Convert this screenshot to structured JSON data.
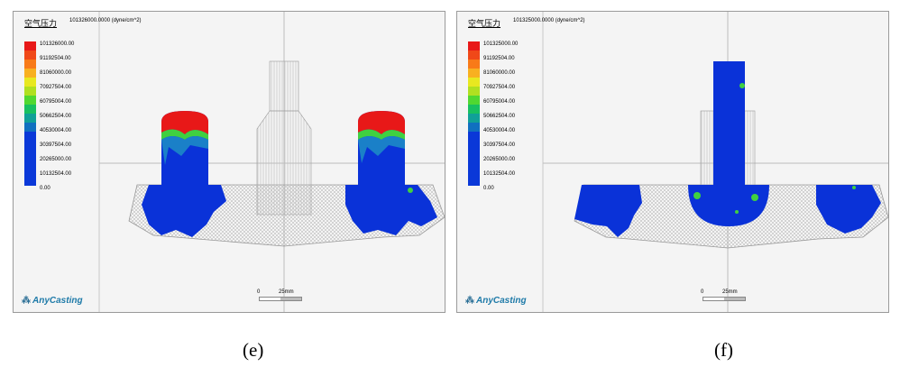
{
  "panels": [
    {
      "id": "e",
      "title": "空气压力",
      "units": "101326000.0000 (dyne/cm^2)",
      "legend_labels": [
        "101326000.00",
        "91192504.00",
        "81060000.00",
        "70927504.00",
        "60795004.00",
        "50662504.00",
        "40530004.00",
        "30397504.00",
        "20265000.00",
        "10132504.00",
        "0.00"
      ],
      "brand": "AnyCasting",
      "scale": {
        "start": "0",
        "end": "25mm"
      },
      "caption": "(e)"
    },
    {
      "id": "f",
      "title": "空气压力",
      "units": "101325000.0000 (dyne/cm^2)",
      "legend_labels": [
        "101325000.00",
        "91192504.00",
        "81060000.00",
        "70927504.00",
        "60795004.00",
        "50662504.00",
        "40530004.00",
        "30397504.00",
        "20265000.00",
        "10132504.00",
        "0.00"
      ],
      "brand": "AnyCasting",
      "scale": {
        "start": "0",
        "end": "25mm"
      },
      "caption": "(f)"
    }
  ],
  "legend_colors": [
    "#e81818",
    "#f04818",
    "#f87a18",
    "#f8b020",
    "#e8e820",
    "#b0e020",
    "#50d830",
    "#18c060",
    "#10a098",
    "#1070c0",
    "#0a38d8"
  ],
  "colors": {
    "pressure_high": "#e81818",
    "pressure_mid": "#40d040",
    "pressure_low": "#0a32d8",
    "mesh": "#a8a8a8"
  }
}
